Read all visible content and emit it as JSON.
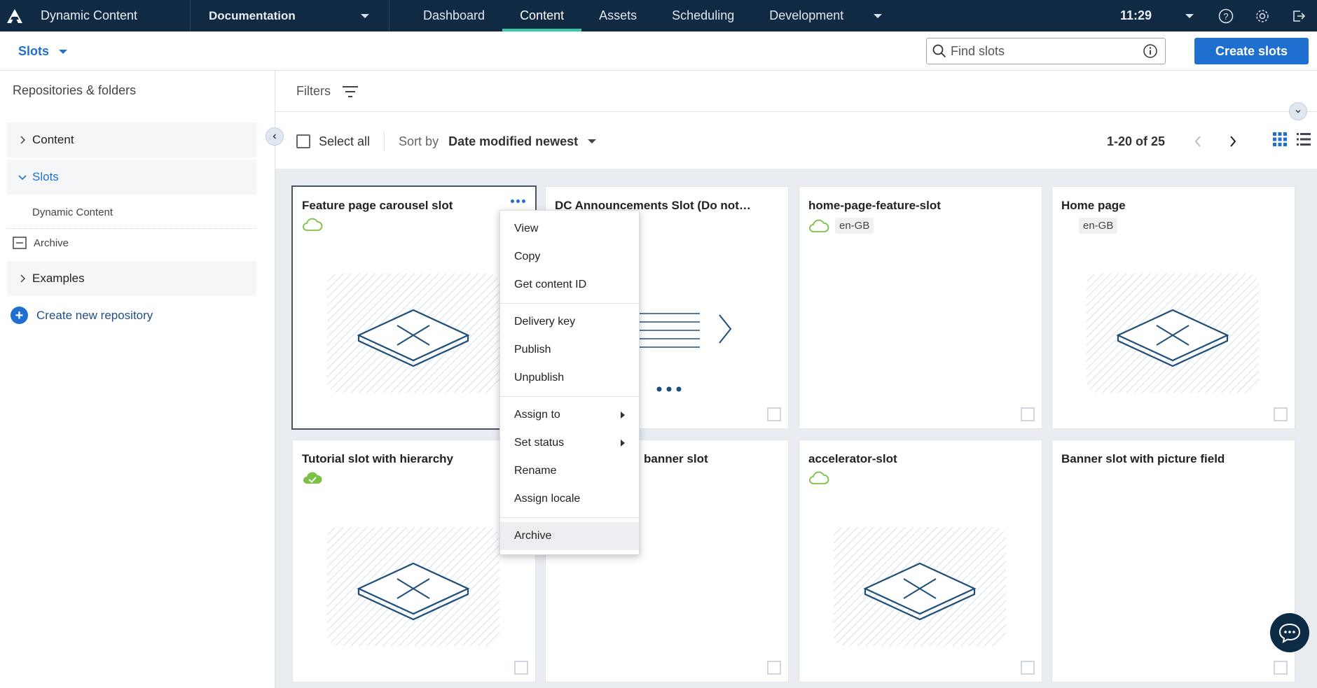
{
  "app": {
    "title": "Dynamic Content"
  },
  "hub": {
    "label": "Documentation"
  },
  "nav": {
    "tabs": [
      {
        "label": "Dashboard"
      },
      {
        "label": "Content"
      },
      {
        "label": "Assets"
      },
      {
        "label": "Scheduling"
      },
      {
        "label": "Development"
      }
    ],
    "active": "Content"
  },
  "top_right": {
    "clock": "11:29"
  },
  "subheader": {
    "view_label": "Slots",
    "search_placeholder": "Find slots",
    "create_label": "Create slots"
  },
  "sidebar": {
    "title": "Repositories & folders",
    "items": [
      {
        "label": "Content"
      },
      {
        "label": "Slots"
      },
      {
        "label": "Examples"
      }
    ],
    "slots_children": [
      {
        "label": "Dynamic Content"
      }
    ],
    "archive_label": "Archive",
    "create_repo_label": "Create new repository"
  },
  "main": {
    "filters_label": "Filters",
    "select_all_label": "Select all",
    "sort_label": "Sort by",
    "sort_value": "Date modified newest",
    "pagination": "1-20 of 25"
  },
  "cards": [
    {
      "title": "Feature page carousel slot",
      "status": "cloud-outline-icon",
      "locale": ""
    },
    {
      "title": "DC Announcements Slot (Do not ...",
      "status": "",
      "locale": ""
    },
    {
      "title": "home-page-feature-slot",
      "status": "cloud-outline-icon",
      "locale": "en-GB"
    },
    {
      "title": "Home page",
      "status": "",
      "locale": "en-GB"
    },
    {
      "title": "Tutorial slot with hierarchy",
      "status": "cloud-check-icon",
      "locale": ""
    },
    {
      "title": "banner slot",
      "status": "",
      "locale": ""
    },
    {
      "title": "accelerator-slot",
      "status": "cloud-outline-icon",
      "locale": ""
    },
    {
      "title": "Banner slot with picture field",
      "status": "",
      "locale": ""
    }
  ],
  "context_menu": {
    "groups": [
      [
        "View",
        "Copy",
        "Get content ID"
      ],
      [
        "Delivery key",
        "Publish",
        "Unpublish"
      ],
      [
        "Assign to",
        "Set status",
        "Rename",
        "Assign locale"
      ],
      [
        "Archive"
      ]
    ]
  },
  "colors": {
    "topbar": "#102a43",
    "accent": "#1f6fd1",
    "nav_indicator": "#35c9a5",
    "published": "#7bc142"
  }
}
